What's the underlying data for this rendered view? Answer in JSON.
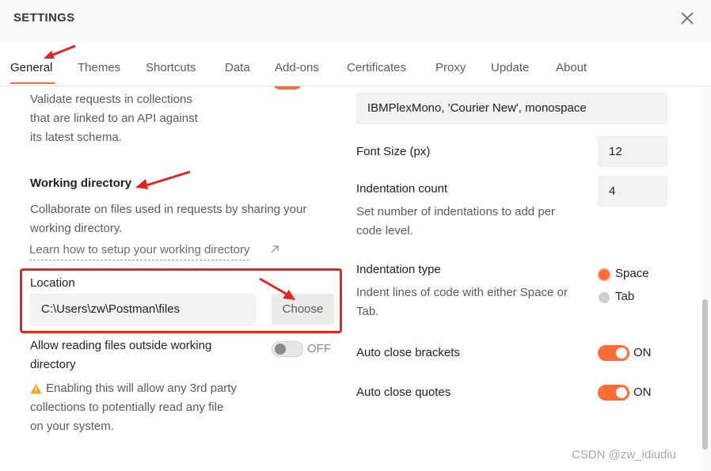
{
  "header": {
    "title": "SETTINGS",
    "close_icon": "close-icon"
  },
  "tabs": [
    {
      "label": "General",
      "active": true
    },
    {
      "label": "Themes"
    },
    {
      "label": "Shortcuts"
    },
    {
      "label": "Data"
    },
    {
      "label": "Add-ons"
    },
    {
      "label": "Certificates"
    },
    {
      "label": "Proxy"
    },
    {
      "label": "Update"
    },
    {
      "label": "About"
    }
  ],
  "left": {
    "validate": {
      "lines": [
        "Validate requests in collections",
        "that are linked to an API against",
        "its latest schema."
      ]
    },
    "working_directory": {
      "heading": "Working directory",
      "description": [
        "Collaborate on files used in requests by sharing your",
        "working directory."
      ],
      "learn_link": "Learn how to setup your working directory"
    },
    "location": {
      "label": "Location",
      "value": "C:\\Users\\zw\\Postman\\files",
      "choose_label": "Choose"
    },
    "allow_outside": {
      "label": [
        "Allow reading files outside working",
        "directory"
      ],
      "toggle_label": "OFF",
      "warning": [
        "Enabling this will allow any 3rd party",
        "collections to potentially read any file",
        "on your system."
      ]
    }
  },
  "right": {
    "font_family": {
      "value": "IBMPlexMono, 'Courier New', monospace"
    },
    "font_size": {
      "label": "Font Size (px)",
      "value": "12"
    },
    "indentation_count": {
      "label": "Indentation count",
      "description": [
        "Set number of indentations to add per",
        "code level."
      ],
      "value": "4"
    },
    "indentation_type": {
      "label": "Indentation type",
      "description": [
        "Indent lines of code with either Space or",
        "Tab."
      ],
      "options": [
        {
          "label": "Space",
          "selected": true
        },
        {
          "label": "Tab",
          "selected": false
        }
      ]
    },
    "auto_close_brackets": {
      "label": "Auto close brackets",
      "toggle_label": "ON"
    },
    "auto_close_quotes": {
      "label": "Auto close quotes",
      "toggle_label": "ON"
    }
  },
  "colors": {
    "accent": "#ff6c37",
    "annotation_red": "#e52420",
    "text": "#212121",
    "muted_text": "#5a5a5a"
  },
  "watermark": "CSDN @zw_idiudiu"
}
